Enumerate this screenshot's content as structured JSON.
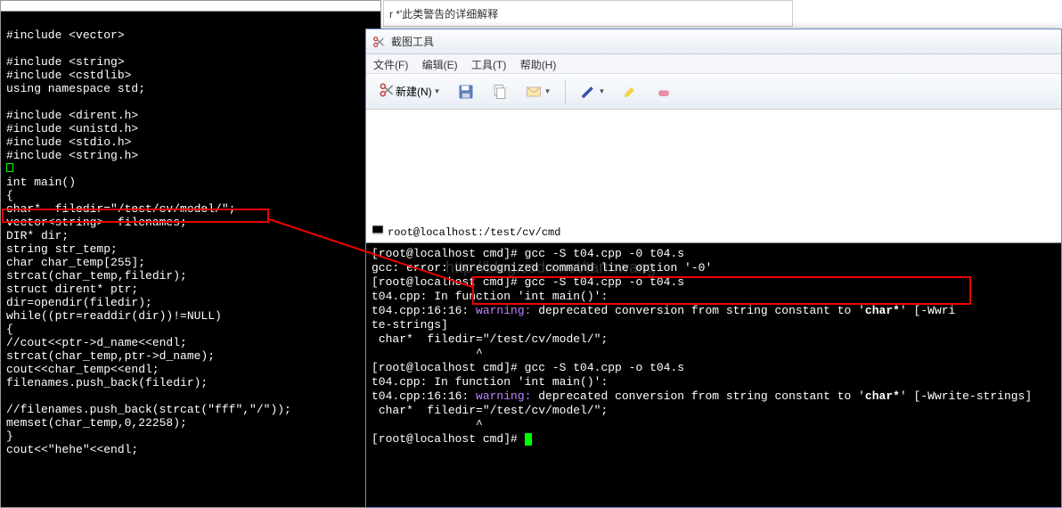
{
  "leftTitleText": "root@localhost:/test/cv/cmd",
  "codeLines": {
    "l1": "#include <vector>",
    "l2": "",
    "l3": "#include <string>",
    "l4": "#include <cstdlib>",
    "l5": "using namespace std;",
    "l6": "",
    "l7": "#include <dirent.h>",
    "l8": "#include <unistd.h>",
    "l9": "#include <stdio.h>",
    "l10": "#include <string.h>",
    "l11": "",
    "l12": "int main()",
    "l13": "{",
    "l14": "char*  filedir=\"/test/cv/model/\";",
    "l15": "vector<string>  filenames;",
    "l16": "DIR* dir;",
    "l17": "string str_temp;",
    "l18": "char char_temp[255];",
    "l19": "strcat(char_temp,filedir);",
    "l20": "struct dirent* ptr;",
    "l21": "dir=opendir(filedir);",
    "l22": "while((ptr=readdir(dir))!=NULL)",
    "l23": "{",
    "l24": "//cout<<ptr->d_name<<endl;",
    "l25": "strcat(char_temp,ptr->d_name);",
    "l26": "cout<<char_temp<<endl;",
    "l27": "filenames.push_back(filedir);",
    "l28": "",
    "l29": "//filenames.push_back(strcat(\"fff\",\"/\"));",
    "l30": "memset(char_temp,0,22258);",
    "l31": "}",
    "l32": "cout<<\"hehe\"<<endl;"
  },
  "topRight": {
    "text": "r *'此类警告的详细解释"
  },
  "snip": {
    "title": "截图工具",
    "menu": {
      "file": "文件(F)",
      "edit": "编辑(E)",
      "tools": "工具(T)",
      "help": "帮助(H)"
    },
    "toolbar": {
      "new": "新建(N)"
    }
  },
  "terminal": {
    "title": "root@localhost:/test/cv/cmd",
    "prompt1": "[root@localhost cmd]# ",
    "cmd1": "gcc -S t04.cpp -0 t04.s",
    "gccerr": "gcc: error: unrecognized command line option '-0'",
    "cmd2": "gcc -S t04.cpp -o t04.s",
    "infunc": "t04.cpp: In function 'int main()':",
    "warnline1a": "t04.cpp:16:16: ",
    "warnword": "warning:",
    "warnline1b": " deprecated conversion from string constant to '",
    "warnbold": "char*",
    "warnline1c": "' [-Wwri",
    "warnline1c2": "te-strings]",
    "srcline": " char*  filedir=\"/test/cv/model/\";",
    "caret": "               ^",
    "cmd3": "gcc -S t04.cpp -o t04.s",
    "warnline2c": "' [-Wwrite-strings]"
  },
  "watermark": "http://blog.csdn.net/tarmwang"
}
